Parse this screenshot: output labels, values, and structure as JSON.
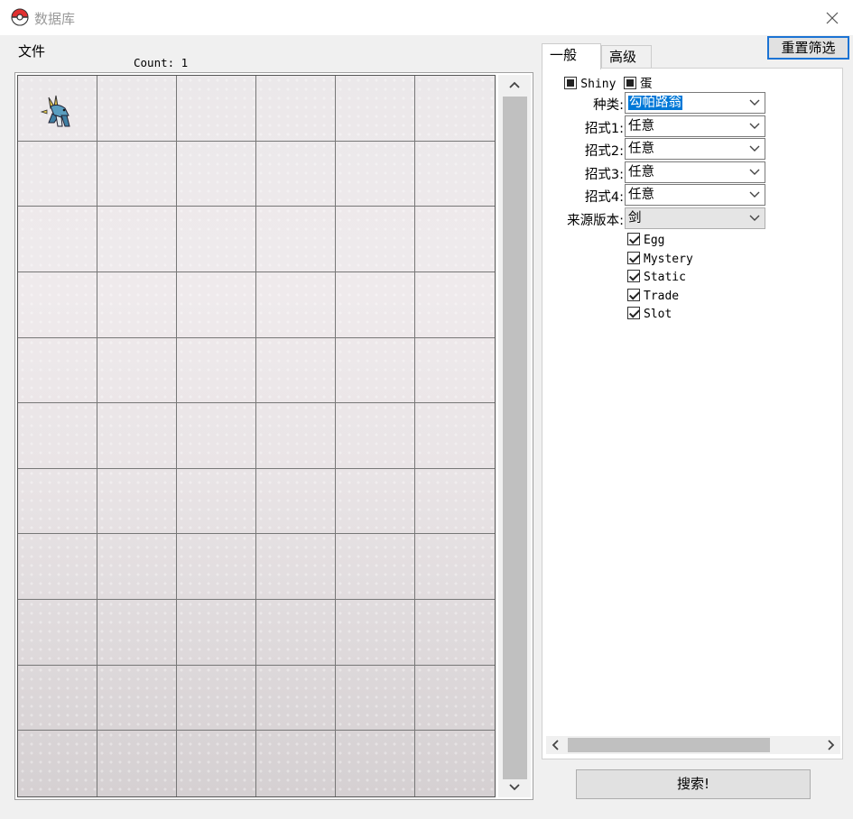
{
  "window": {
    "title": "数据库",
    "app_icon": "pokeball-icon",
    "close_icon": "close-icon"
  },
  "menu": {
    "file": "文件"
  },
  "results": {
    "count_text": "Count: 1"
  },
  "grid": {
    "columns": 6,
    "rows": 11,
    "filled_slots": [
      0
    ],
    "slot_icon": "pokemon-sprite-icon"
  },
  "tabs": [
    {
      "label": "一般",
      "active": true
    },
    {
      "label": "高级",
      "active": false
    }
  ],
  "buttons": {
    "reset_filters": "重置筛选",
    "search": "搜索!"
  },
  "filters": {
    "shiny_label": "Shiny",
    "egg_label": "蛋",
    "species": {
      "label": "种类:",
      "value": "勾帕路翁"
    },
    "move1": {
      "label": "招式1:",
      "value": "任意"
    },
    "move2": {
      "label": "招式2:",
      "value": "任意"
    },
    "move3": {
      "label": "招式3:",
      "value": "任意"
    },
    "move4": {
      "label": "招式4:",
      "value": "任意"
    },
    "origin_game": {
      "label": "来源版本:",
      "value": "剑"
    }
  },
  "encounter_types": [
    {
      "label": "Egg",
      "checked": true
    },
    {
      "label": "Mystery",
      "checked": true
    },
    {
      "label": "Static",
      "checked": true
    },
    {
      "label": "Trade",
      "checked": true
    },
    {
      "label": "Slot",
      "checked": true
    }
  ],
  "colors": {
    "accent": "#0078d7",
    "button_border_focus": "#1b73d4",
    "button_bg": "#e1e1e1",
    "window_bg": "#f0f0f0"
  }
}
